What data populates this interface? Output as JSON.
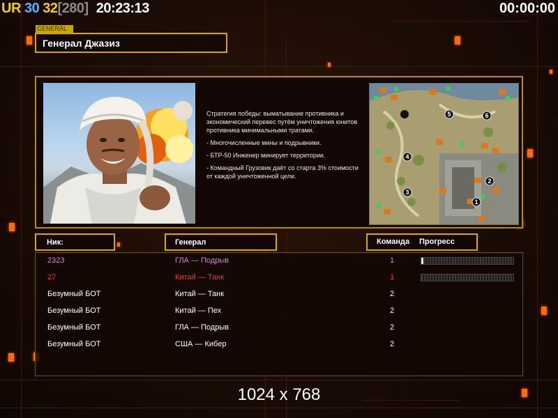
{
  "topbar": {
    "fps_ur": "UR",
    "fps_30": "30",
    "fps_32": "32",
    "fps_280": "[280]",
    "clock": "20:23:13",
    "timer": "00:00:00"
  },
  "general": {
    "tag": "GENERAL",
    "name": "Генерал Джазиз"
  },
  "description": [
    "Стратегия победы: выматывание противника и экономический перевес путём уничтожения юнитов противника минимальными тратами.",
    "- Многочисленные мины и подрывники.",
    "- БТР-50 Инженер минирует территории.",
    "- Командный Грузовик даёт со старта 3% стоимости от каждой уничтоженной цели."
  ],
  "minimap": {
    "start_positions": [
      "1",
      "2",
      "3",
      "4",
      "5",
      "6"
    ]
  },
  "table": {
    "headers": {
      "nick": "Ник:",
      "general": "Генерал",
      "team": "Команда",
      "progress": "Прогресс"
    },
    "rows": [
      {
        "nick": "2323",
        "general": "ГЛА — Подрыв",
        "team": "1",
        "color": "#c78bd6",
        "progress": 0.02
      },
      {
        "nick": "27",
        "general": "Китай — Танк",
        "team": "1",
        "color": "#e83a2a",
        "progress": 0.0
      },
      {
        "nick": "Безумный БОТ",
        "general": "Китай — Танк",
        "team": "2",
        "color": "#ffffff"
      },
      {
        "nick": "Безумный БОТ",
        "general": "Китай — Пех",
        "team": "2",
        "color": "#ffffff"
      },
      {
        "nick": "Безумный БОТ",
        "general": "ГЛА — Подрыв",
        "team": "2",
        "color": "#ffffff"
      },
      {
        "nick": "Безумный БОТ",
        "general": "США — Кибер",
        "team": "2",
        "color": "#ffffff"
      }
    ]
  },
  "resolution": "1024 x 768"
}
